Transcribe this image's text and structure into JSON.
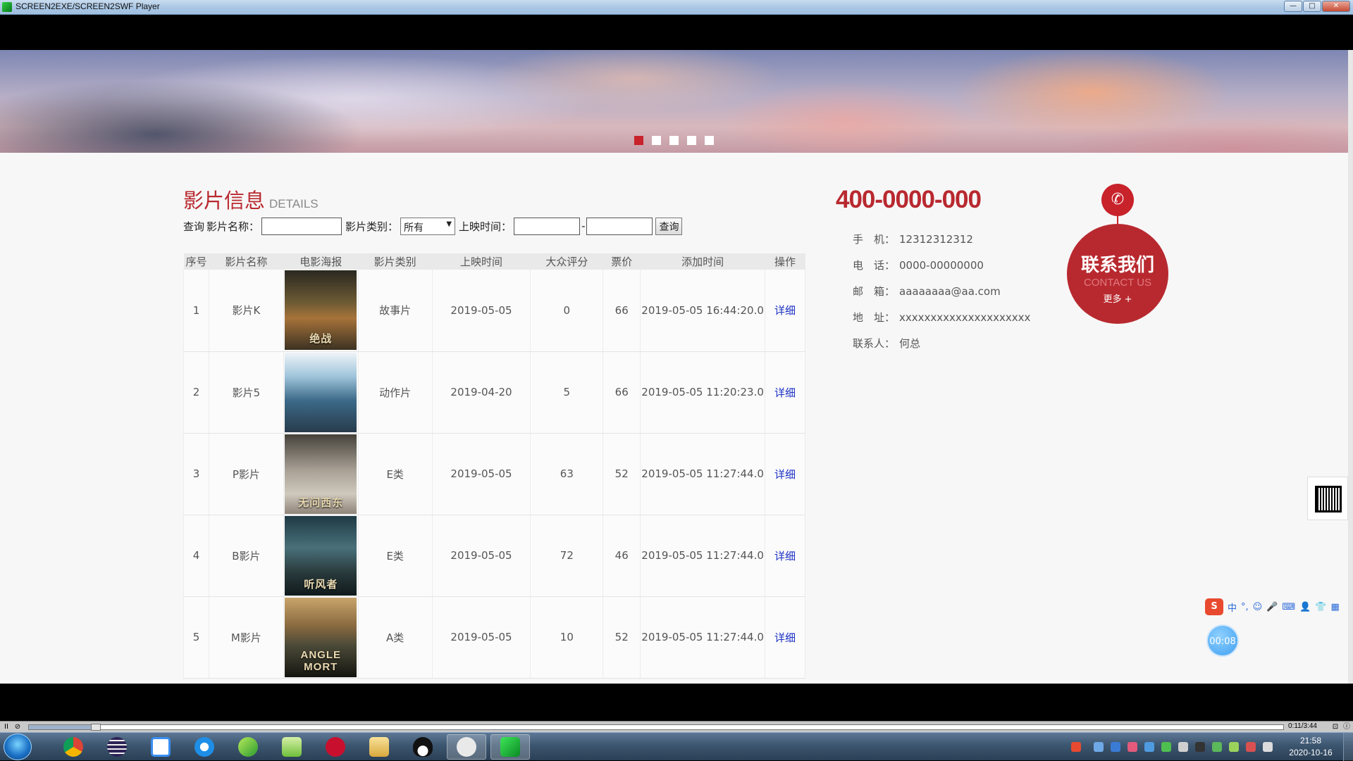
{
  "window": {
    "title": "SCREEN2EXE/SCREEN2SWF Player",
    "minimize": "—",
    "maximize": "□",
    "close": "✕"
  },
  "banner": {
    "slides": 5,
    "active_slide": 1
  },
  "details": {
    "title": "影片信息",
    "subtitle": "DETAILS",
    "search": {
      "query_label": "查询",
      "name_label": "影片名称：",
      "name_value": "",
      "category_label": "影片类别：",
      "category_value": "所有",
      "date_label": "上映时间：",
      "date_from": "",
      "date_to": "",
      "date_separator": "-",
      "button": "查询"
    },
    "table": {
      "headers": [
        "序号",
        "影片名称",
        "电影海报",
        "影片类别",
        "上映时间",
        "大众评分",
        "票价",
        "添加时间",
        "操作"
      ],
      "rows": [
        {
          "no": "1",
          "name": "影片K",
          "poster_text": "绝战",
          "category": "故事片",
          "release": "2019-05-05",
          "score": "0",
          "price": "66",
          "added": "2019-05-05 16:44:20.0",
          "action": "详细"
        },
        {
          "no": "2",
          "name": "影片5",
          "poster_text": "",
          "category": "动作片",
          "release": "2019-04-20",
          "score": "5",
          "price": "66",
          "added": "2019-05-05 11:20:23.0",
          "action": "详细"
        },
        {
          "no": "3",
          "name": "P影片",
          "poster_text": "无问西东",
          "category": "E类",
          "release": "2019-05-05",
          "score": "63",
          "price": "52",
          "added": "2019-05-05 11:27:44.0",
          "action": "详细"
        },
        {
          "no": "4",
          "name": "B影片",
          "poster_text": "听风者",
          "category": "E类",
          "release": "2019-05-05",
          "score": "72",
          "price": "46",
          "added": "2019-05-05 11:27:44.0",
          "action": "详细"
        },
        {
          "no": "5",
          "name": "M影片",
          "poster_text": "ANGLE MORT",
          "category": "A类",
          "release": "2019-05-05",
          "score": "10",
          "price": "52",
          "added": "2019-05-05 11:27:44.0",
          "action": "详细"
        }
      ]
    }
  },
  "contact": {
    "hotline": "400-0000-000",
    "items": [
      {
        "key": "手　机：",
        "value": "12312312312"
      },
      {
        "key": "电　话：",
        "value": "0000-00000000"
      },
      {
        "key": "邮　箱：",
        "value": "aaaaaaaa@aa.com"
      },
      {
        "key": "地　址：",
        "value": "xxxxxxxxxxxxxxxxxxxxx"
      },
      {
        "key": "联系人：",
        "value": "何总"
      }
    ],
    "badge_cn": "联系我们",
    "badge_en": "CONTACT US",
    "badge_more": "更多 +",
    "phone_glyph": "✆"
  },
  "ime": {
    "logo": "S",
    "mode": "中",
    "punct": "°,",
    "emoji": "☺",
    "mic": "🎤",
    "keyboard": "⌨",
    "user": "👤",
    "shirt": "👕",
    "grid": "▦"
  },
  "recorder": {
    "elapsed": "00:08"
  },
  "player": {
    "time": "0:11/3:44",
    "progress_fraction": 0.05,
    "pause": "II",
    "stop": "⊘",
    "fullscreen": "⊡",
    "info": "ⓘ"
  },
  "taskbar": {
    "apps": [
      "chrome",
      "eclipse",
      "baidu-netdisk",
      "qq-browser",
      "green-app",
      "notepad-plus",
      "flash",
      "explorer",
      "qq",
      "wechat",
      "screen2exe-player"
    ],
    "active_app": "screen2exe-player",
    "clock_time": "21:58",
    "clock_date": "2020-10-16"
  },
  "colors": {
    "accent_red": "#b8292f",
    "link_blue": "#1b30c4"
  }
}
